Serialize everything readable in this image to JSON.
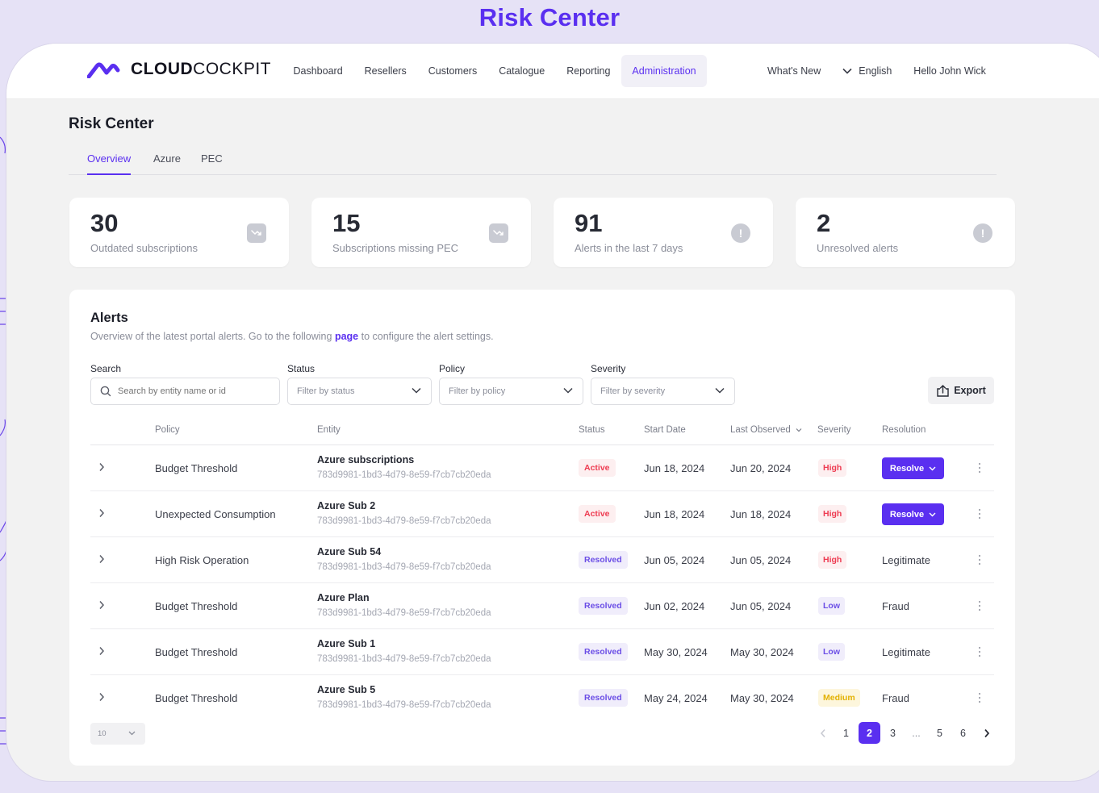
{
  "showcase": {
    "title": "Risk Center"
  },
  "brand": {
    "logo_bold": "CLOUD",
    "logo_thin": "COCKPIT",
    "accent": "#5a2ff0"
  },
  "nav": {
    "items": [
      {
        "label": "Dashboard"
      },
      {
        "label": "Resellers"
      },
      {
        "label": "Customers"
      },
      {
        "label": "Catalogue"
      },
      {
        "label": "Reporting"
      },
      {
        "label": "Administration",
        "active": true
      }
    ],
    "whats_new": "What's New",
    "language": "English",
    "greeting": "Hello John Wick"
  },
  "page": {
    "title": "Risk Center",
    "tabs": [
      {
        "label": "Overview",
        "active": true
      },
      {
        "label": "Azure"
      },
      {
        "label": "PEC"
      }
    ]
  },
  "stats": [
    {
      "value": "30",
      "label": "Outdated subscriptions",
      "icon": "trend-down-icon"
    },
    {
      "value": "15",
      "label": "Subscriptions missing PEC",
      "icon": "trend-down-icon"
    },
    {
      "value": "91",
      "label": "Alerts in the last 7 days",
      "icon": "alert-circle-icon"
    },
    {
      "value": "2",
      "label": "Unresolved alerts",
      "icon": "alert-circle-icon"
    }
  ],
  "alerts": {
    "title": "Alerts",
    "subtitle_prefix": "Overview of the latest portal alerts. Go to the following ",
    "subtitle_link": "page",
    "subtitle_suffix": " to configure the alert settings.",
    "filters": {
      "search_label": "Search",
      "search_placeholder": "Search by entity name or id",
      "status_label": "Status",
      "status_value": "Filter by status",
      "policy_label": "Policy",
      "policy_value": "Filter by policy",
      "severity_label": "Severity",
      "severity_value": "Filter by severity"
    },
    "export_label": "Export",
    "columns": {
      "policy": "Policy",
      "entity": "Entity",
      "status": "Status",
      "start_date": "Start Date",
      "last_observed": "Last Observed",
      "severity": "Severity",
      "resolution": "Resolution"
    },
    "rows": [
      {
        "policy": "Budget Threshold",
        "entity": "Azure subscriptions",
        "id": "783d9981-1bd3-4d79-8e59-f7cb7cb20eda",
        "status": "Active",
        "start": "Jun 18, 2024",
        "last": "Jun 20, 2024",
        "severity": "High",
        "resolution": "Resolve"
      },
      {
        "policy": "Unexpected Consumption",
        "entity": "Azure Sub 2",
        "id": "783d9981-1bd3-4d79-8e59-f7cb7cb20eda",
        "status": "Active",
        "start": "Jun 18, 2024",
        "last": "Jun 18, 2024",
        "severity": "High",
        "resolution": "Resolve"
      },
      {
        "policy": "High Risk Operation",
        "entity": "Azure Sub 54",
        "id": "783d9981-1bd3-4d79-8e59-f7cb7cb20eda",
        "status": "Resolved",
        "start": "Jun 05, 2024",
        "last": "Jun 05, 2024",
        "severity": "High",
        "resolution": "Legitimate"
      },
      {
        "policy": "Budget Threshold",
        "entity": "Azure Plan",
        "id": "783d9981-1bd3-4d79-8e59-f7cb7cb20eda",
        "status": "Resolved",
        "start": "Jun 02, 2024",
        "last": "Jun 05, 2024",
        "severity": "Low",
        "resolution": "Fraud"
      },
      {
        "policy": "Budget Threshold",
        "entity": "Azure Sub 1",
        "id": "783d9981-1bd3-4d79-8e59-f7cb7cb20eda",
        "status": "Resolved",
        "start": "May 30, 2024",
        "last": "May 30, 2024",
        "severity": "Low",
        "resolution": "Legitimate"
      },
      {
        "policy": "Budget Threshold",
        "entity": "Azure Sub 5",
        "id": "783d9981-1bd3-4d79-8e59-f7cb7cb20eda",
        "status": "Resolved",
        "start": "May 24, 2024",
        "last": "May 30, 2024",
        "severity": "Medium",
        "resolution": "Fraud"
      }
    ],
    "page_size": "10",
    "pagination": [
      "1",
      "2",
      "3",
      "...",
      "5",
      "6"
    ],
    "current_page": "2"
  }
}
